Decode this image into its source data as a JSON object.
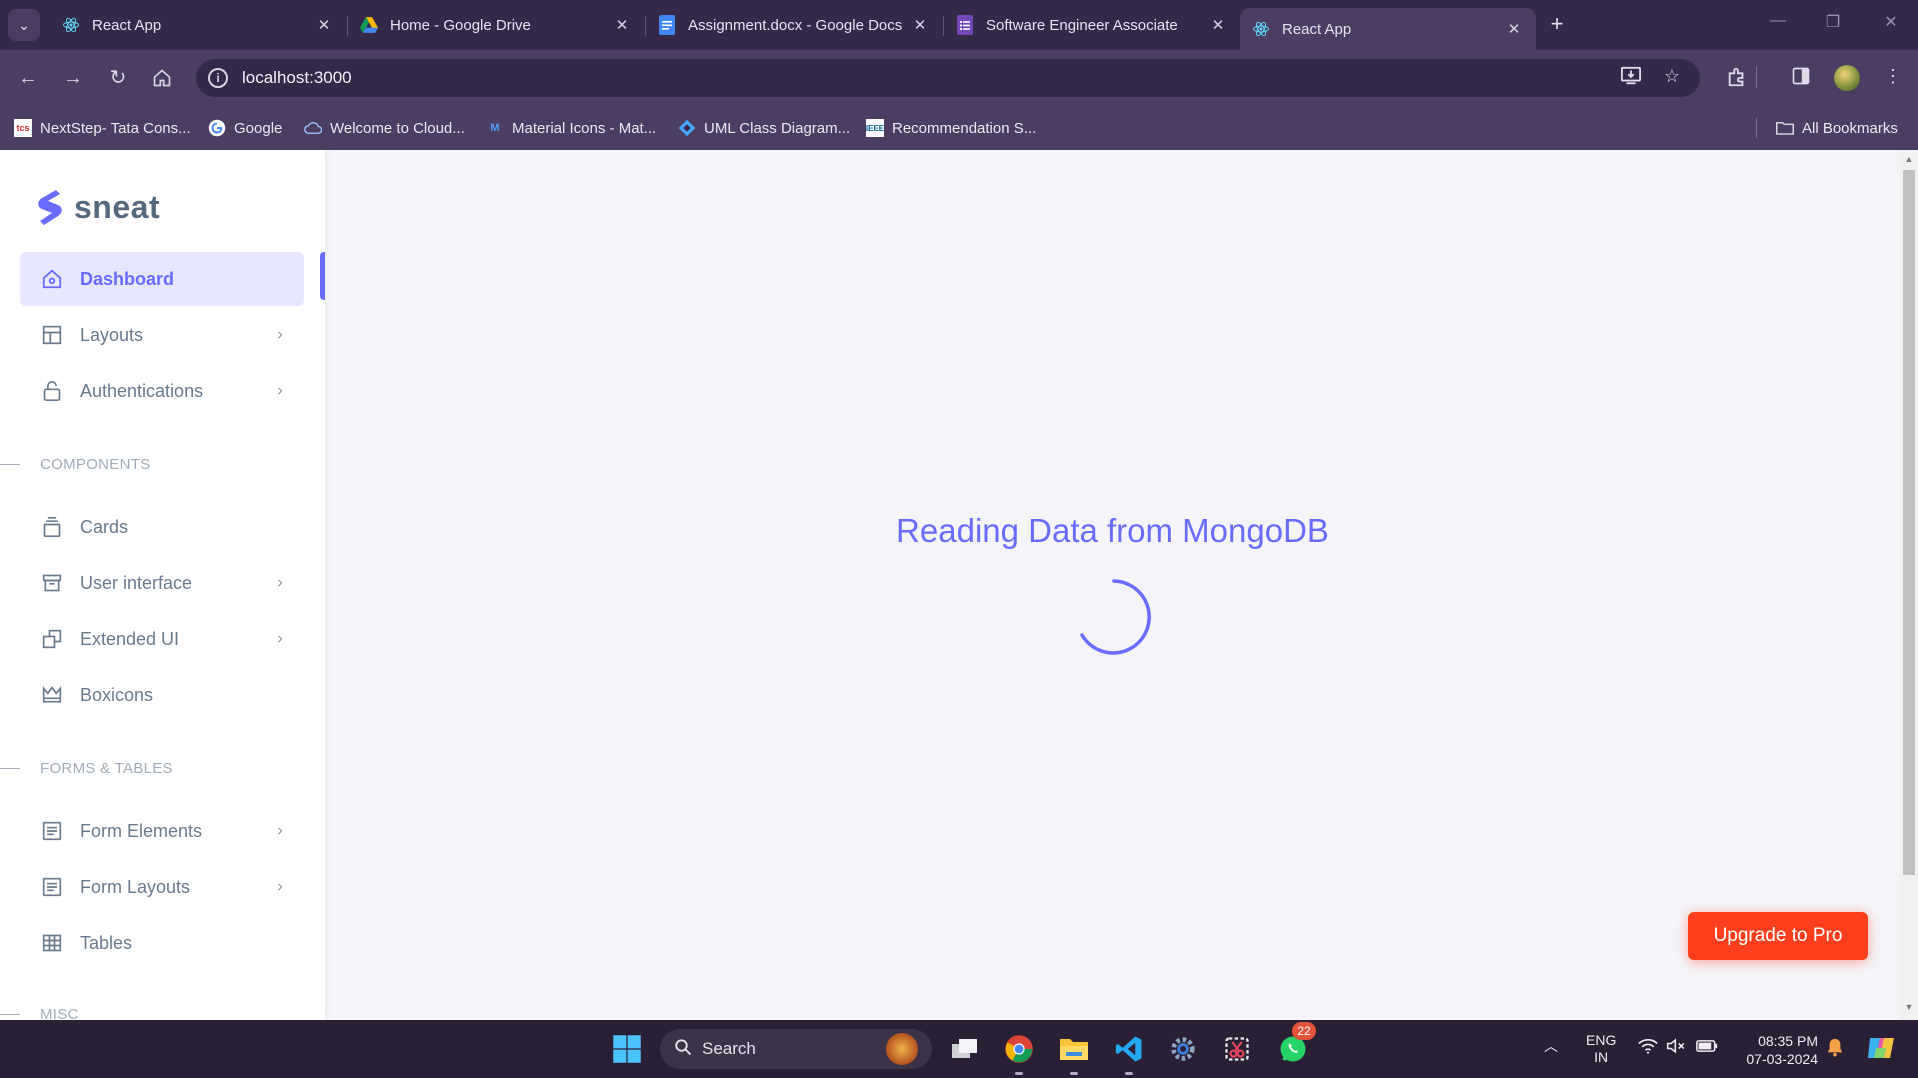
{
  "browser": {
    "tabs": [
      {
        "label": "React App",
        "icon": "react-icon",
        "active": false
      },
      {
        "label": "Home - Google Drive",
        "icon": "google-drive-icon",
        "active": false
      },
      {
        "label": "Assignment.docx - Google Docs",
        "icon": "google-docs-icon",
        "active": false
      },
      {
        "label": "Software Engineer Associate",
        "icon": "google-forms-icon",
        "active": false
      },
      {
        "label": "React App",
        "icon": "react-icon",
        "active": true
      }
    ],
    "url": "localhost:3000",
    "bookmarks": [
      {
        "label": "NextStep- Tata Cons...",
        "icon": "tcs-icon"
      },
      {
        "label": "Google",
        "icon": "google-icon"
      },
      {
        "label": "Welcome to Cloud...",
        "icon": "cloud-icon"
      },
      {
        "label": "Material Icons - Mat...",
        "icon": "material-icon"
      },
      {
        "label": "UML Class Diagram...",
        "icon": "uml-icon"
      },
      {
        "label": "Recommendation S...",
        "icon": "ieee-icon"
      }
    ],
    "all_bookmarks_label": "All Bookmarks"
  },
  "sidebar": {
    "brand": "sneat",
    "items": [
      {
        "label": "Dashboard",
        "icon": "home-icon",
        "active": true,
        "has_submenu": false
      },
      {
        "label": "Layouts",
        "icon": "layout-icon",
        "has_submenu": true
      },
      {
        "label": "Authentications",
        "icon": "lock-icon",
        "has_submenu": true
      }
    ],
    "components_heading": "COMPONENTS",
    "components": [
      {
        "label": "Cards",
        "icon": "cards-icon",
        "has_submenu": false
      },
      {
        "label": "User interface",
        "icon": "box-icon",
        "has_submenu": true
      },
      {
        "label": "Extended UI",
        "icon": "copy-icon",
        "has_submenu": true
      },
      {
        "label": "Boxicons",
        "icon": "crown-icon",
        "has_submenu": false
      }
    ],
    "forms_heading": "FORMS & TABLES",
    "forms": [
      {
        "label": "Form Elements",
        "icon": "detail-icon",
        "has_submenu": true
      },
      {
        "label": "Form Layouts",
        "icon": "detail-icon",
        "has_submenu": true
      },
      {
        "label": "Tables",
        "icon": "table-icon",
        "has_submenu": false
      }
    ],
    "misc_heading": "MISC"
  },
  "main": {
    "loading_text": "Reading Data from MongoDB"
  },
  "upgrade_button": "Upgrade to Pro",
  "taskbar": {
    "search_label": "Search",
    "whatsapp_badge": "22",
    "lang_top": "ENG",
    "lang_bottom": "IN",
    "time": "08:35 PM",
    "date": "07-03-2024"
  },
  "colors": {
    "accent": "#696cff",
    "upgrade": "#ff3e1d",
    "chrome_dark": "#35294a",
    "chrome": "#4b3e62"
  }
}
